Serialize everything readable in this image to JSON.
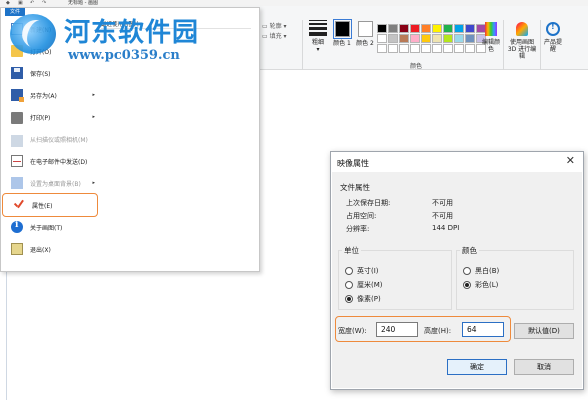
{
  "window": {
    "title": "无标题 - 画图",
    "quick_access": [
      "◆",
      "▣",
      "↶",
      "↷"
    ]
  },
  "ribbon": {
    "shape_options": [
      "轮廓",
      "填充"
    ],
    "size_label": "粗细",
    "color1_label": "颜色 1",
    "color2_label": "颜色 2",
    "palette_label": "颜色",
    "edit_colors_label": "编辑颜色",
    "paint3d_label": "使用画图 3D 进行编辑",
    "product_alert_label": "产品提醒",
    "palette_colors": [
      "#000000",
      "#7f7f7f",
      "#880015",
      "#ed1c24",
      "#ff7f27",
      "#fff200",
      "#22b14c",
      "#00a2e8",
      "#3f48cc",
      "#a349a4",
      "#ffffff",
      "#c3c3c3",
      "#b97a57",
      "#ffaec9",
      "#ffc90e",
      "#efe4b0",
      "#b5e61d",
      "#99d9ea",
      "#7092be",
      "#c8bfe7",
      "#ffffff",
      "#ffffff",
      "#ffffff",
      "#ffffff",
      "#ffffff",
      "#ffffff",
      "#ffffff",
      "#ffffff",
      "#ffffff",
      "#ffffff"
    ],
    "color1": "#000000",
    "color2": "#ffffff"
  },
  "file_menu": {
    "tab_label": "文件",
    "recent_header": "最近使用的图片",
    "commands": [
      {
        "label": "新建(N)",
        "icon": "new-file-icon",
        "disabled": false,
        "submenu": false
      },
      {
        "label": "打开(O)",
        "icon": "open-folder-icon",
        "disabled": false,
        "submenu": false
      },
      {
        "label": "保存(S)",
        "icon": "save-disk-icon",
        "disabled": false,
        "submenu": false
      },
      {
        "label": "另存为(A)",
        "icon": "save-as-icon",
        "disabled": false,
        "submenu": true
      },
      {
        "label": "打印(P)",
        "icon": "printer-icon",
        "disabled": false,
        "submenu": true
      },
      {
        "label": "从扫描仪或照相机(M)",
        "icon": "scanner-icon",
        "disabled": true,
        "submenu": false
      },
      {
        "label": "在电子邮件中发送(D)",
        "icon": "email-icon",
        "disabled": false,
        "submenu": false
      },
      {
        "label": "设置为桌面背景(B)",
        "icon": "desktop-background-icon",
        "disabled": true,
        "submenu": true
      },
      {
        "label": "属性(E)",
        "icon": "checkmark-icon",
        "disabled": false,
        "submenu": false,
        "highlight": true
      },
      {
        "label": "关于画图(T)",
        "icon": "info-icon",
        "disabled": false,
        "submenu": false
      },
      {
        "label": "退出(X)",
        "icon": "exit-icon",
        "disabled": false,
        "submenu": false
      }
    ]
  },
  "watermark": {
    "title": "河东软件园",
    "url": "www.pc0359.cn"
  },
  "properties_dialog": {
    "title": "映像属性",
    "close_glyph": "✕",
    "file_attributes": {
      "heading": "文件属性",
      "rows": [
        {
          "key": "上次保存日期:",
          "value": "不可用"
        },
        {
          "key": "占用空间:",
          "value": "不可用"
        },
        {
          "key": "分辨率:",
          "value": "144 DPI"
        }
      ]
    },
    "units": {
      "heading": "单位",
      "options": [
        "英寸(I)",
        "厘米(M)",
        "像素(P)"
      ],
      "selected": 2
    },
    "colors": {
      "heading": "颜色",
      "options": [
        "黑白(B)",
        "彩色(L)"
      ],
      "selected": 1
    },
    "width_label": "宽度(W):",
    "width_value": "240",
    "height_label": "高度(H):",
    "height_value": "64",
    "default_button": "默认值(D)",
    "ok_button": "确定",
    "cancel_button": "取消"
  }
}
